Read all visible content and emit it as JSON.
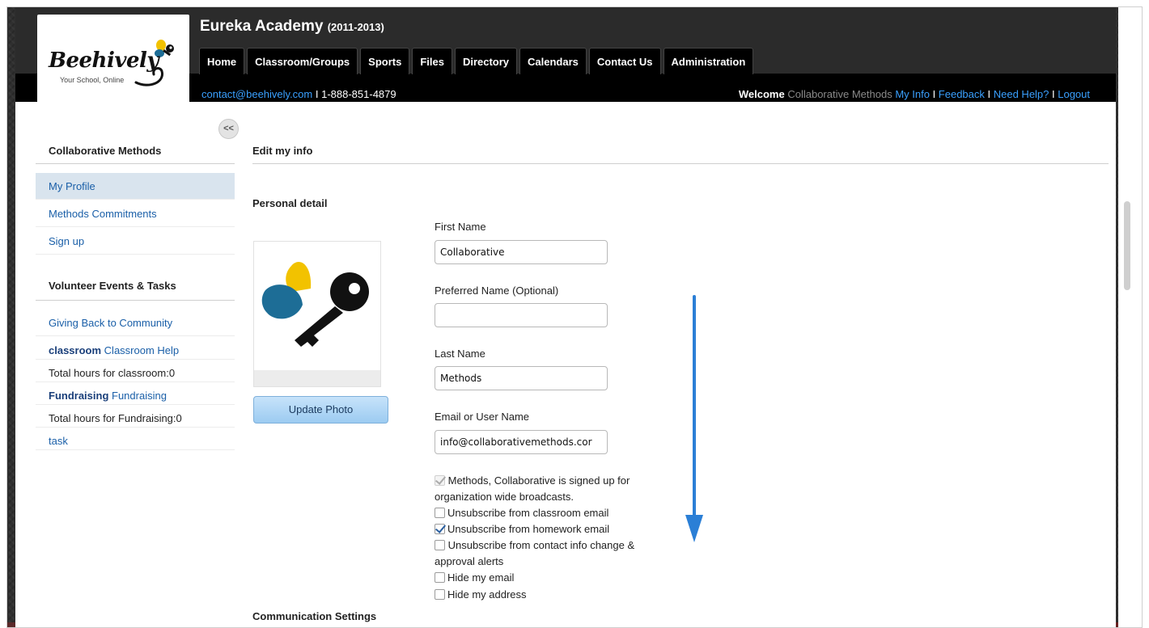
{
  "header": {
    "school_name": "Eureka Academy",
    "school_years": "(2011-2013)",
    "logo_text": "Beehively",
    "logo_tagline": "Your School, Online",
    "nav": [
      "Home",
      "Classroom/Groups",
      "Sports",
      "Files",
      "Directory",
      "Calendars",
      "Contact Us",
      "Administration"
    ],
    "contact_email": "contact@beehively.com",
    "contact_sep": " I ",
    "contact_phone": "1-888-851-4879",
    "welcome_label": "Welcome",
    "welcome_name": "Collaborative Methods",
    "links": {
      "my_info": "My Info",
      "feedback": "Feedback",
      "need_help": "Need Help?",
      "logout": "Logout"
    },
    "sep": " I "
  },
  "sidebar": {
    "collapse_label": "<<",
    "heading_user": "Collaborative Methods",
    "items": [
      {
        "label": "My Profile",
        "active": true
      },
      {
        "label": "Methods Commitments"
      },
      {
        "label": "Sign up"
      }
    ],
    "heading_volunteer": "Volunteer Events & Tasks",
    "volunteer_link": "Giving Back to Community",
    "rows": [
      {
        "tag": "classroom",
        "link": "Classroom Help"
      },
      {
        "text": "Total hours for classroom:0"
      },
      {
        "tag": "Fundraising",
        "link": "Fundraising"
      },
      {
        "text": "Total hours for Fundraising:0"
      },
      {
        "link": "task"
      }
    ]
  },
  "main": {
    "title": "Edit my info",
    "section_personal": "Personal detail",
    "update_photo": "Update Photo",
    "fields": {
      "first_name_label": "First Name",
      "first_name_value": "Collaborative",
      "preferred_label": "Preferred Name (Optional)",
      "preferred_value": "",
      "last_name_label": "Last Name",
      "last_name_value": "Methods",
      "email_label": "Email or User Name",
      "email_value": "info@collaborativemethods.cor"
    },
    "checks": {
      "broadcast": "Methods, Collaborative is signed up for organization wide broadcasts.",
      "unsub_classroom": "Unsubscribe from classroom email",
      "unsub_homework": "Unsubscribe from homework email",
      "unsub_contact": "Unsubscribe from contact info change & approval alerts",
      "hide_email": "Hide my email",
      "hide_address": "Hide my address"
    },
    "section_communication": "Communication Settings"
  },
  "colors": {
    "link": "#3aa0ff",
    "annotation_arrow": "#2b7fd6",
    "logo_yellow": "#f2c200",
    "logo_blue": "#1d6d96"
  }
}
